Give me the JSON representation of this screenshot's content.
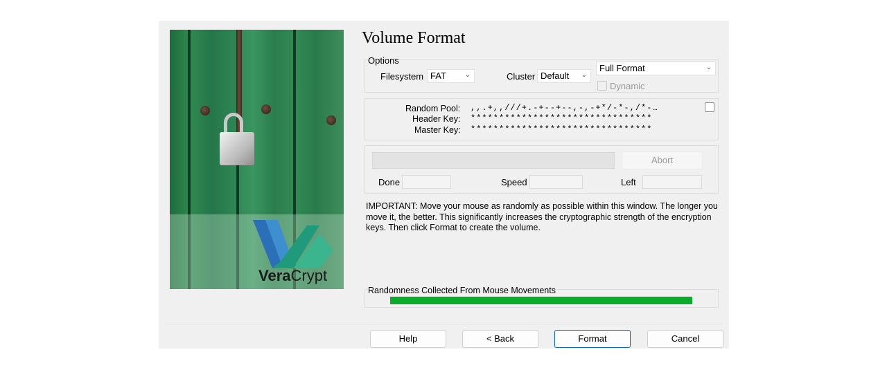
{
  "title": "Volume Format",
  "artwork": {
    "brand_prefix": "Vera",
    "brand_suffix": "Crypt"
  },
  "options": {
    "group_label": "Options",
    "filesystem_label": "Filesystem",
    "filesystem_value": "FAT",
    "cluster_label": "Cluster",
    "cluster_value": "Default",
    "format_mode_value": "Full Format",
    "dynamic_label": "Dynamic"
  },
  "keys": {
    "random_pool_label": "Random Pool:",
    "random_pool_value": ",,.+,,///+.-+--+--,-,-+*/-*-,/*-…",
    "header_key_label": "Header Key:",
    "header_key_value": "********************************",
    "master_key_label": "Master Key:",
    "master_key_value": "********************************"
  },
  "progress": {
    "abort_label": "Abort",
    "done_label": "Done",
    "speed_label": "Speed",
    "left_label": "Left"
  },
  "important_text": "IMPORTANT: Move your mouse as randomly as possible within this window. The longer you move it, the better. This significantly increases the cryptographic strength of the encryption keys. Then click Format to create the volume.",
  "randomness": {
    "label": "Randomness Collected From Mouse Movements",
    "fill_fraction": 1.0,
    "color": "#0cab2e"
  },
  "buttons": {
    "help": "Help",
    "back": "< Back",
    "format": "Format",
    "cancel": "Cancel"
  }
}
